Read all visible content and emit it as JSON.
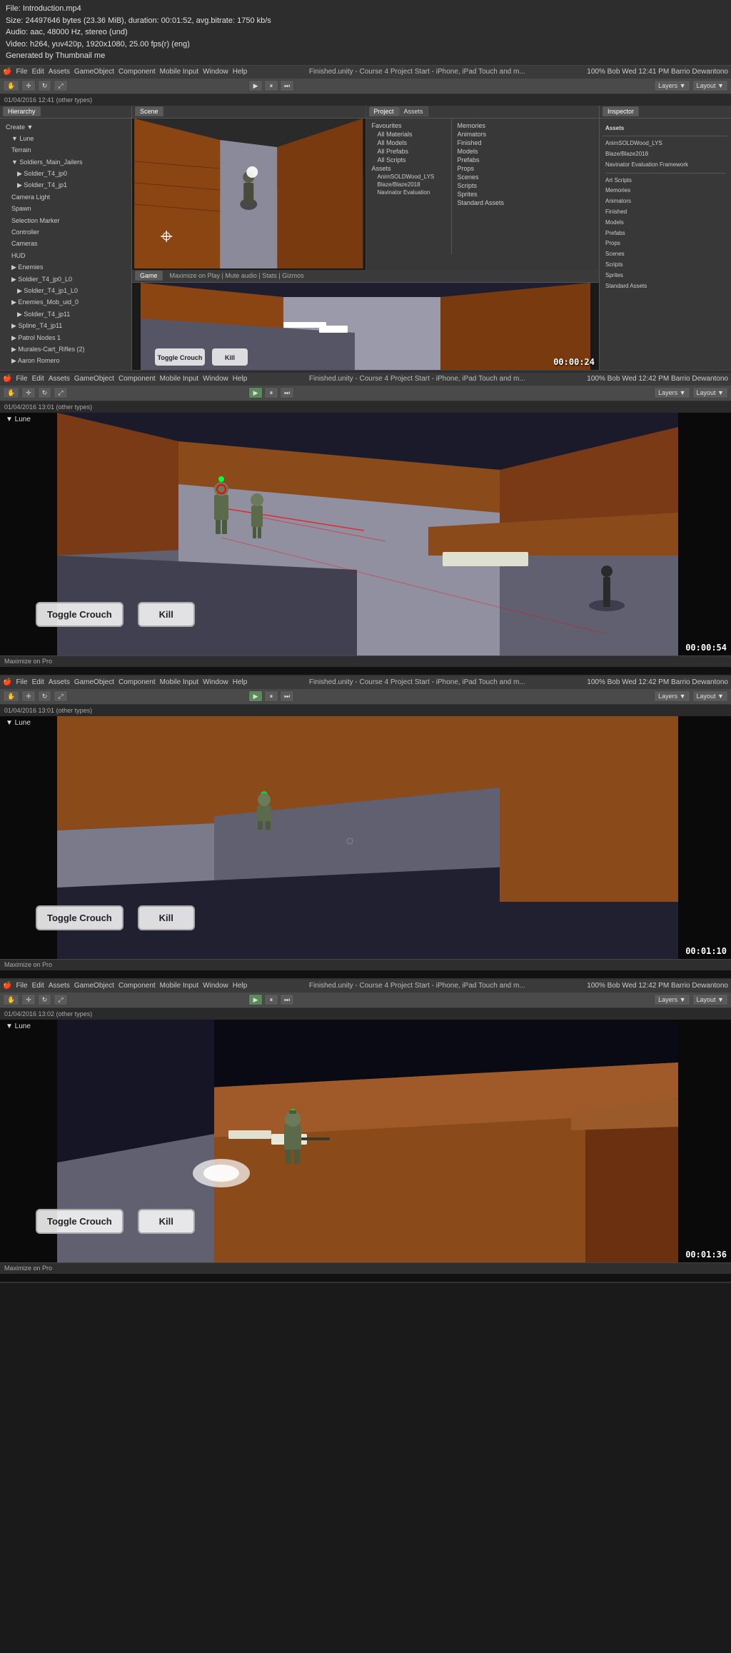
{
  "file_info": {
    "line1": "File: Introduction.mp4",
    "line2": "Size: 24497646 bytes (23.36 MiB), duration: 00:01:52, avg.bitrate: 1750 kb/s",
    "line3": "Audio: aac, 48000 Hz, stereo (und)",
    "line4": "Video: h264, yuv420p, 1920x1080, 25.00 fps(r) (eng)",
    "line5": "Generated by Thumbnail me"
  },
  "sections": [
    {
      "id": "section1",
      "timestamp": "00:00:24",
      "file_bar": "01/04/2016 12:41 (other types)",
      "title": "Finished.unity - Course 4 Project Start - iPhone, iPad Touch and m...",
      "top_right": "100% Bob Wed 12:41 PM  Barrio Dewantono",
      "buttons": {
        "crouch": "Toggle Crouch",
        "kill": "Kill"
      },
      "hierarchy_items": [
        "Favourites",
        "All Materials",
        "All Models",
        "All Prefabs",
        "All Scripts",
        "Assets",
        "AnimSOLDWood_LYS",
        "Blaze/Blaze2018",
        "Navinator Evaluation Framework"
      ],
      "right_panel_items": [
        "Memories",
        "Animators",
        "Finished",
        "Models",
        "Prefabs",
        "Props",
        "Scenes",
        "Scripts",
        "Sprites",
        "Standard Assets"
      ]
    },
    {
      "id": "section2",
      "timestamp": "00:00:54",
      "file_bar": "01/04/2016 13:01 (other types)",
      "title": "Finished.unity - Course 4 Project Start - iPhone, iPad Touch and m...",
      "top_right": "100% Bob Wed 12:42 PM  Barrio Dewantono",
      "buttons": {
        "crouch": "Toggle Crouch",
        "kill": "Kill"
      }
    },
    {
      "id": "section3",
      "timestamp": "00:01:10",
      "file_bar": "01/04/2016 13:01 (other types)",
      "title": "Finished.unity - Course 4 Project Start - iPhone, iPad Touch and m...",
      "top_right": "100% Bob Wed 12:42 PM  Barrio Dewantono",
      "buttons": {
        "crouch": "Toggle Crouch",
        "kill": "Kill"
      }
    },
    {
      "id": "section4",
      "timestamp": "00:01:36",
      "file_bar": "01/04/2016 13:02 (other types)",
      "title": "Finished.unity - Course 4 Project Start - iPhone, iPad Touch and m...",
      "top_right": "100% Bob Wed 12:42 PM  Barrio Dewantono",
      "buttons": {
        "crouch": "Toggle Crouch",
        "kill": "Kill"
      }
    }
  ],
  "menu_items": [
    "File",
    "Edit",
    "Assets",
    "GameObject",
    "Component",
    "Mobile Input",
    "Window",
    "Help"
  ],
  "toolbar": {
    "play": "▶",
    "pause": "⏸",
    "step": "⏭"
  }
}
